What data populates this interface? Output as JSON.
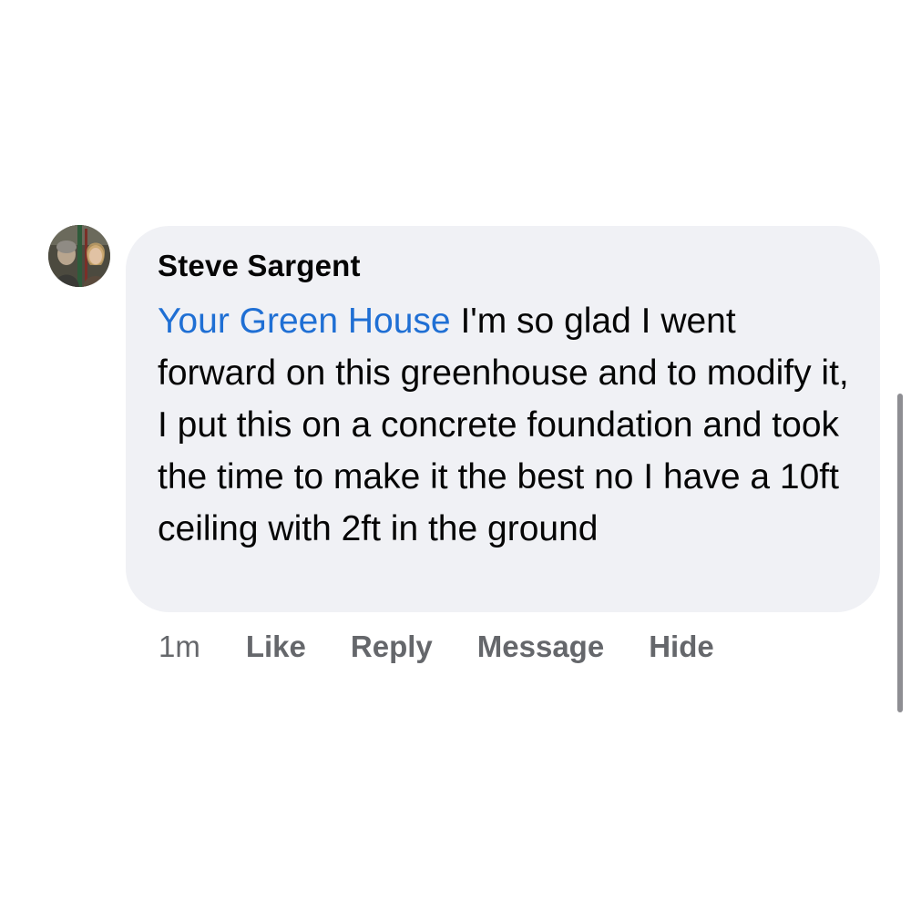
{
  "comment": {
    "author": "Steve Sargent",
    "mention": "Your Green House",
    "text": " I'm so glad I went forward on this greenhouse and to modify it, I put this on a concrete foundation and took the time to make it the best no I have a 10ft ceiling with 2ft in the ground",
    "avatar_icon": "profile-photo-icon"
  },
  "actions": {
    "timestamp": "1m",
    "like_label": "Like",
    "reply_label": "Reply",
    "message_label": "Message",
    "hide_label": "Hide"
  },
  "colors": {
    "bubble": "#f0f1f5",
    "mention": "#1f6fd4",
    "action_text": "#65676b",
    "body_text": "#050505"
  }
}
